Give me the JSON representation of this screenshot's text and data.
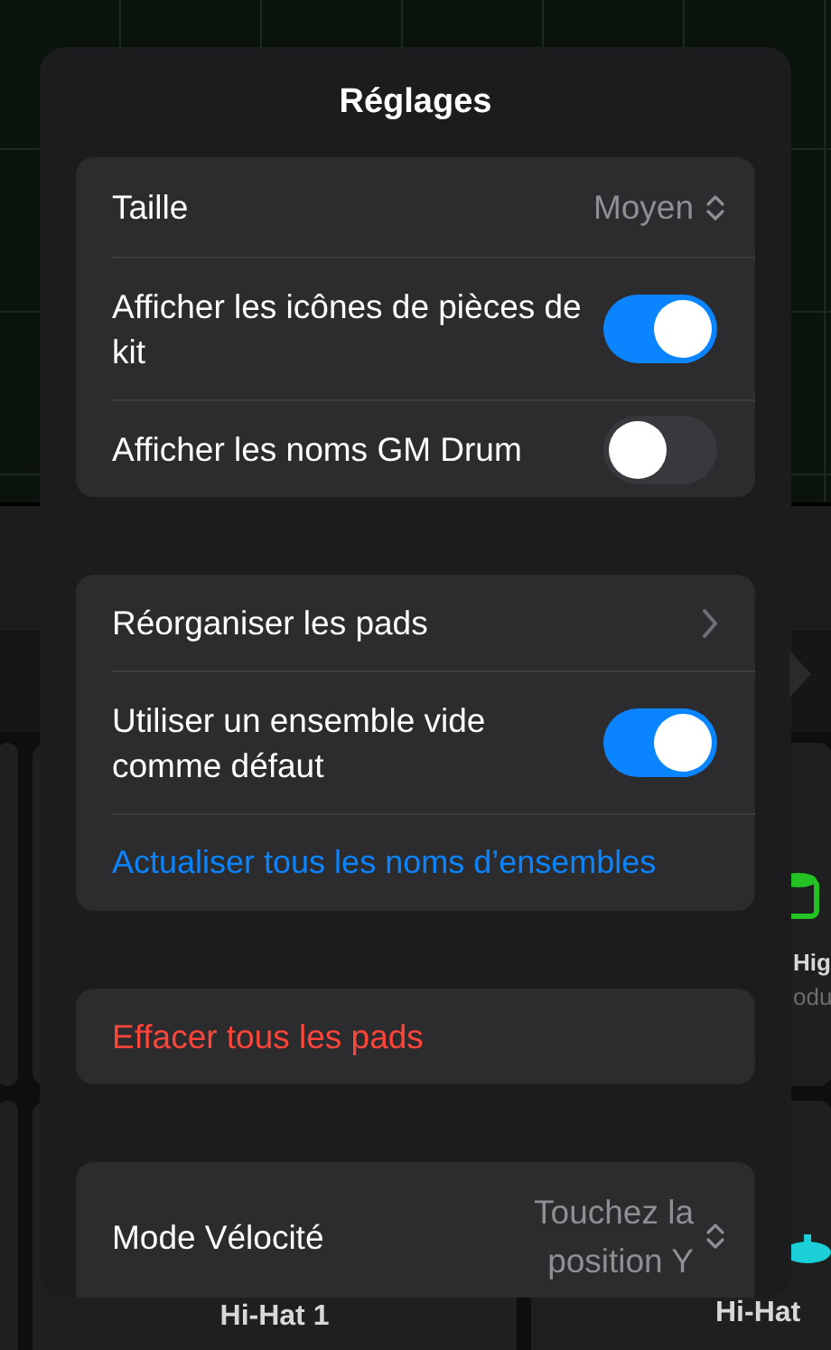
{
  "background": {
    "pad_rows": [
      [
        {
          "kind": "empty"
        },
        {
          "kind": "empty"
        },
        {
          "kind": "drum",
          "label": "Hig",
          "sublabel": "odu"
        }
      ],
      [
        {
          "kind": "empty"
        },
        {
          "kind": "plain",
          "label": "Hi-Hat 1"
        },
        {
          "kind": "cymbal",
          "label": "Hi-Hat"
        }
      ]
    ]
  },
  "popover": {
    "title": "Réglages",
    "groups": [
      {
        "rows": [
          {
            "kind": "select",
            "label": "Taille",
            "value": "Moyen"
          },
          {
            "kind": "toggle",
            "label": "Afficher les icônes de pièces de kit",
            "on": true
          },
          {
            "kind": "toggle",
            "label": "Afficher les noms GM Drum",
            "on": false
          }
        ]
      },
      {
        "rows": [
          {
            "kind": "link",
            "label": "Réorganiser les pads"
          },
          {
            "kind": "toggle",
            "label": "Utiliser un ensemble vide comme défaut",
            "on": true
          },
          {
            "kind": "action",
            "label": "Actualiser tous les noms d’ensembles"
          }
        ]
      },
      {
        "rows": [
          {
            "kind": "destructive",
            "label": "Effacer tous les pads"
          }
        ]
      },
      {
        "rows": [
          {
            "kind": "select",
            "label": "Mode Vélocité",
            "value": "Touchez la position Y"
          }
        ]
      }
    ]
  }
}
